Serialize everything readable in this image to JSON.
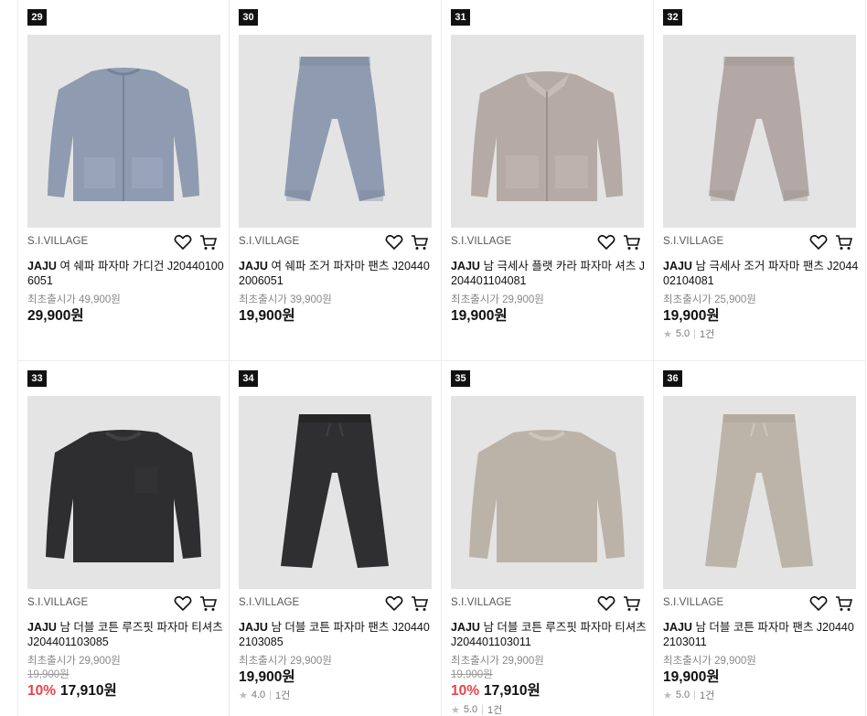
{
  "products": [
    {
      "rank": "29",
      "brand": "S.I.VILLAGE",
      "brand_name": "JAJU",
      "name": " 여 쉐파 파자마 가디건 J204401006051",
      "orig_price": "최초출시가 49,900원",
      "strike_price": "",
      "discount": "",
      "price": "29,900원",
      "rating": "",
      "reviews": "",
      "item": "cardigan",
      "color": "#8e9bb0"
    },
    {
      "rank": "30",
      "brand": "S.I.VILLAGE",
      "brand_name": "JAJU",
      "name": " 여 쉐파 조거 파자마 팬츠 J204402006051",
      "orig_price": "최초출시가 39,900원",
      "strike_price": "",
      "discount": "",
      "price": "19,900원",
      "rating": "",
      "reviews": "",
      "item": "jogger",
      "color": "#8f9bb0"
    },
    {
      "rank": "31",
      "brand": "S.I.VILLAGE",
      "brand_name": "JAJU",
      "name": " 남 극세사 플랫 카라 파자마 셔츠 J204401104081",
      "orig_price": "최초출시가 29,900원",
      "strike_price": "",
      "discount": "",
      "price": "19,900원",
      "rating": "",
      "reviews": "",
      "item": "shirt",
      "color": "#b5aaa5"
    },
    {
      "rank": "32",
      "brand": "S.I.VILLAGE",
      "brand_name": "JAJU",
      "name": " 남 극세사 조거 파자마 팬츠 J204402104081",
      "orig_price": "최초출시가 25,900원",
      "strike_price": "",
      "discount": "",
      "price": "19,900원",
      "rating": "5.0",
      "reviews": "1건",
      "item": "jogger",
      "color": "#b3a8a5"
    },
    {
      "rank": "33",
      "brand": "S.I.VILLAGE",
      "brand_name": "JAJU",
      "name": " 남 더블 코튼 루즈핏 파자마 티셔츠 J204401103085",
      "orig_price": "최초출시가 29,900원",
      "strike_price": "19,900원",
      "discount": "10%",
      "price": "17,910원",
      "rating": "",
      "reviews": "",
      "item": "tee-pocket",
      "color": "#2e2e30"
    },
    {
      "rank": "34",
      "brand": "S.I.VILLAGE",
      "brand_name": "JAJU",
      "name": " 남 더블 코튼 파자마 팬츠 J204402103085",
      "orig_price": "최초출시가 29,900원",
      "strike_price": "",
      "discount": "",
      "price": "19,900원",
      "rating": "4.0",
      "reviews": "1건",
      "item": "pants",
      "color": "#2f2f31"
    },
    {
      "rank": "35",
      "brand": "S.I.VILLAGE",
      "brand_name": "JAJU",
      "name": " 남 더블 코튼 루즈핏 파자마 티셔츠 J204401103011",
      "orig_price": "최초출시가 29,900원",
      "strike_price": "19,900원",
      "discount": "10%",
      "price": "17,910원",
      "rating": "5.0",
      "reviews": "1건",
      "item": "tee",
      "color": "#bcb3a8"
    },
    {
      "rank": "36",
      "brand": "S.I.VILLAGE",
      "brand_name": "JAJU",
      "name": " 남 더블 코튼 파자마 팬츠 J204402103011",
      "orig_price": "최초출시가 29,900원",
      "strike_price": "",
      "discount": "",
      "price": "19,900원",
      "rating": "5.0",
      "reviews": "1건",
      "item": "pants",
      "color": "#bdb4a9"
    }
  ],
  "icons": {
    "wishlist": "heart-icon",
    "cart": "cart-icon",
    "star": "star-icon"
  }
}
